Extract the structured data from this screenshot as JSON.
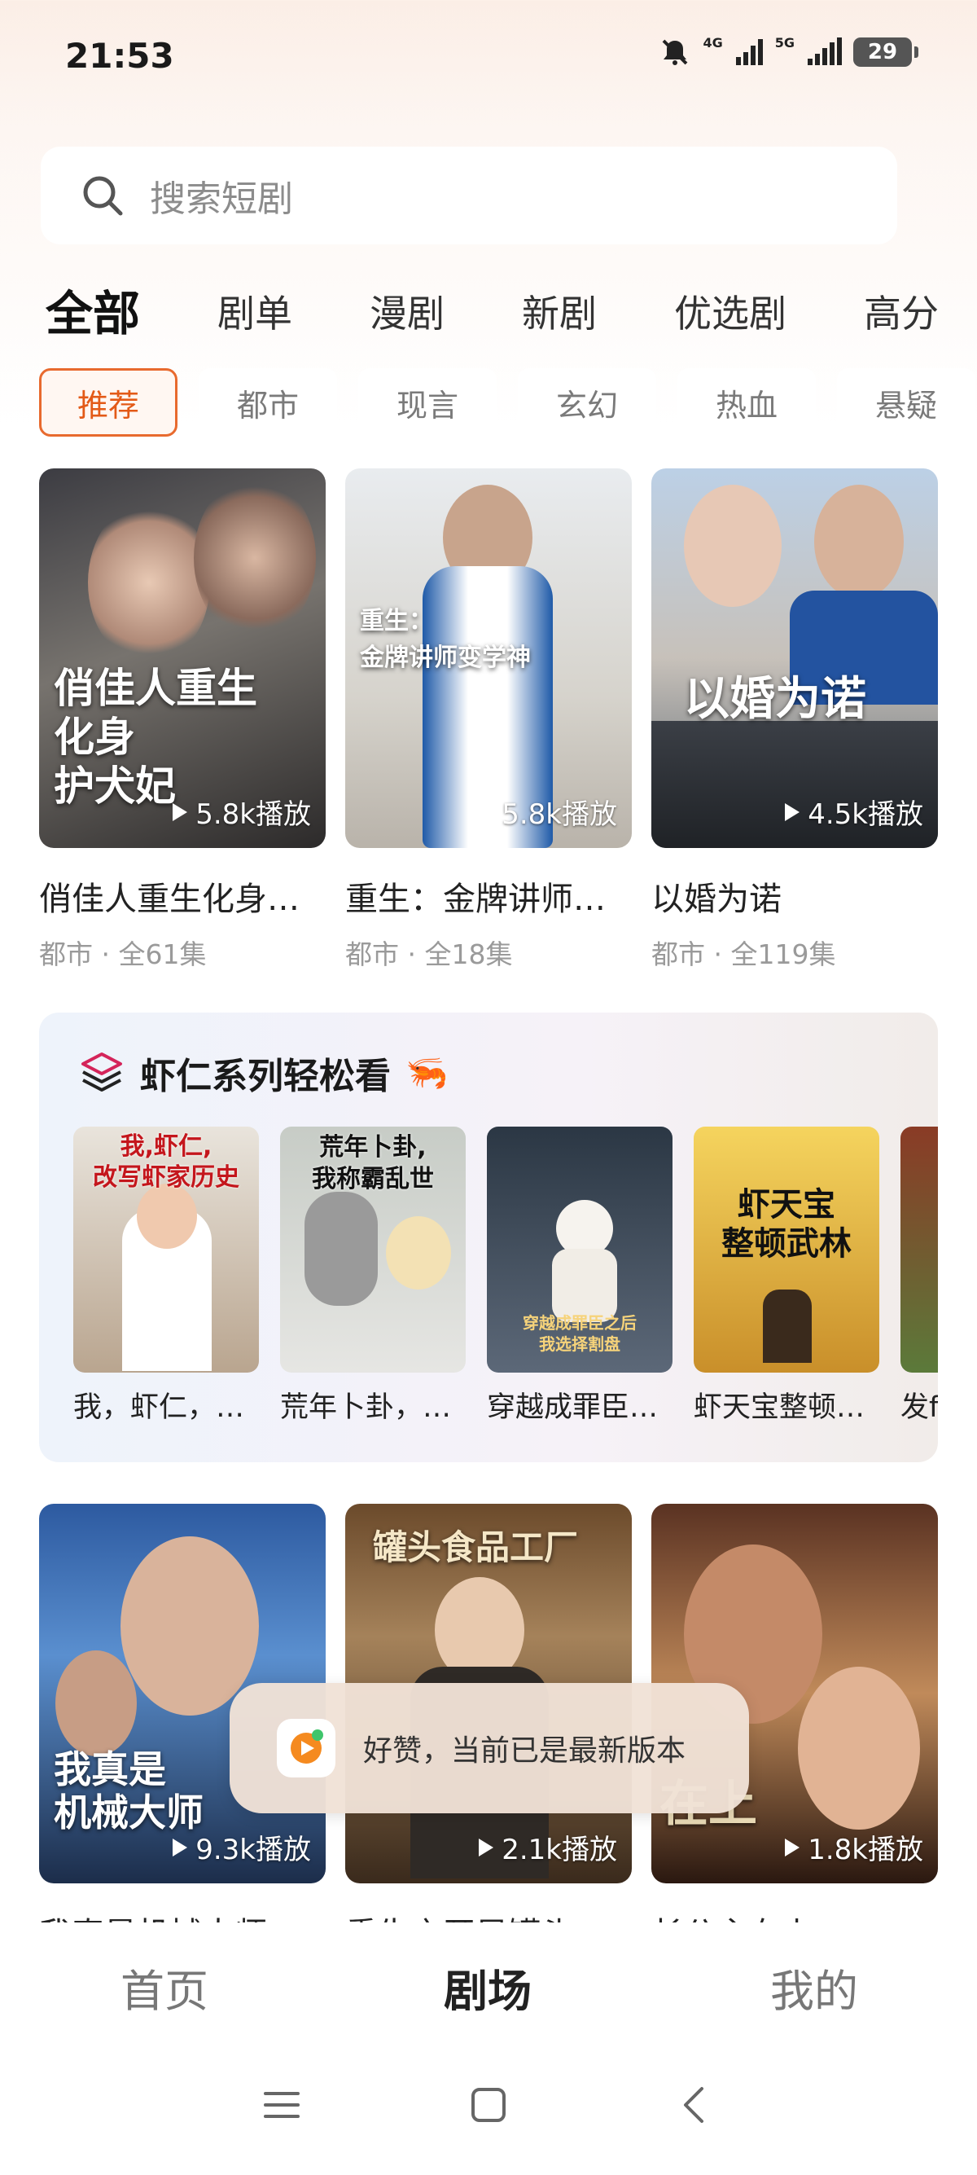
{
  "status_bar": {
    "time": "21:53",
    "net_4g": "4G",
    "net_5g": "5G",
    "battery": "29",
    "icons": [
      "mute-icon",
      "signal-icon",
      "signal-icon"
    ]
  },
  "search": {
    "placeholder": "搜索短剧",
    "icon": "search-icon"
  },
  "top_tabs": [
    "全部",
    "剧单",
    "漫剧",
    "新剧",
    "优选剧",
    "高分"
  ],
  "chips": [
    "推荐",
    "都市",
    "现言",
    "玄幻",
    "热血",
    "悬疑"
  ],
  "row1": [
    {
      "title": "俏佳人重生化身…",
      "meta": "都市 · 全61集",
      "plays": "5.8k播放",
      "poster_text": "俏佳人重生\n化身\n护犬妃"
    },
    {
      "title": "重生：金牌讲师…",
      "meta": "都市 · 全18集",
      "plays": "5.8k播放",
      "poster_text": "重生：\n金牌讲师变学神"
    },
    {
      "title": "以婚为诺",
      "meta": "都市 · 全119集",
      "plays": "4.5k播放",
      "poster_text": "以婚为诺"
    }
  ],
  "series": {
    "title": "虾仁系列轻松看",
    "emoji": "🦐",
    "icon": "layers-icon",
    "items": [
      {
        "title": "我，虾仁，…",
        "poster_text": "我,虾仁,\n改写虾家历史"
      },
      {
        "title": "荒年卜卦，…",
        "poster_text": "荒年卜卦,\n我称霸乱世"
      },
      {
        "title": "穿越成罪臣…",
        "poster_text": "穿越成罪臣之后\n我选择割盘"
      },
      {
        "title": "虾天宝整顿…",
        "poster_text": "虾天宝\n整顿武林"
      },
      {
        "title": "发f",
        "poster_text": ""
      }
    ]
  },
  "row2": [
    {
      "title": "我真是机械大师",
      "plays": "9.3k播放",
      "poster_text": "我真是\n机械大师"
    },
    {
      "title": "重生之开局罐头",
      "plays": "2.1k播放",
      "poster_text": "罐头食品工厂"
    },
    {
      "title": "长公主在上",
      "plays": "1.8k播放",
      "poster_text": "在上"
    }
  ],
  "toast": {
    "message": "好赞，当前已是最新版本",
    "app_icon": "app-logo-icon"
  },
  "bottom_nav": [
    "首页",
    "剧场",
    "我的"
  ],
  "active_nav": "剧场",
  "colors": {
    "accent": "#e86a2e",
    "chip_active_text": "#e35a17"
  }
}
